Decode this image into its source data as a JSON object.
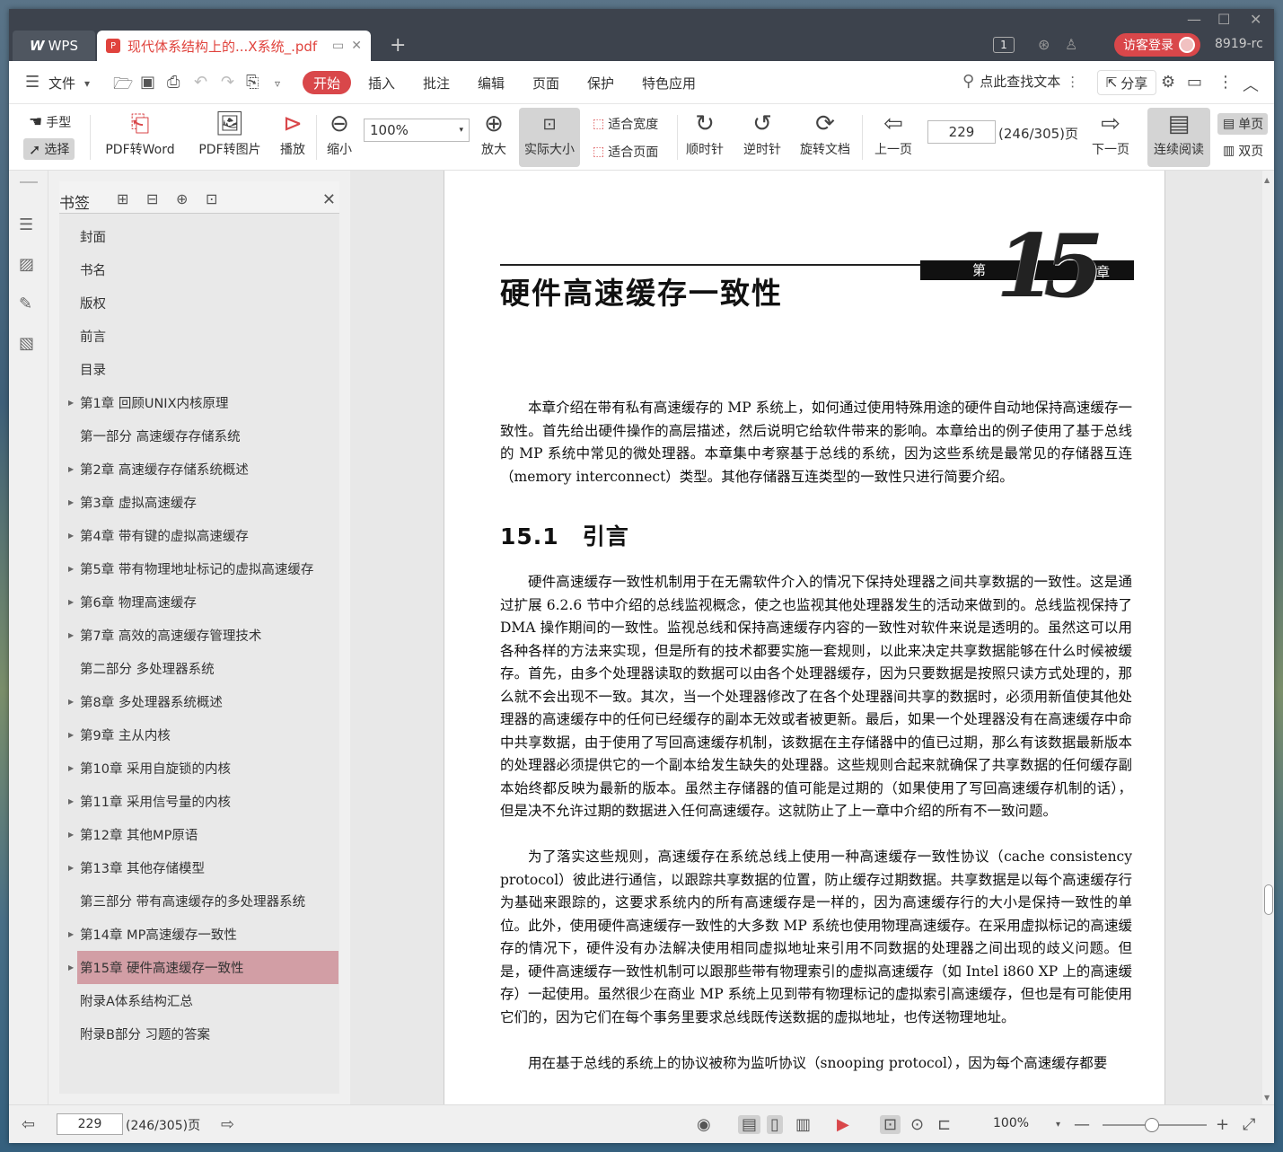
{
  "titlebar": {
    "app_tab": "WPS",
    "doc_tab_title": "现代体系结构上的...X系统_.pdf",
    "new_tab": "+",
    "badge": "1",
    "login": "访客登录",
    "user": "8919-rc",
    "min": "—",
    "max": "☐",
    "close": "✕"
  },
  "menu": {
    "file": "文件",
    "start": "开始",
    "insert": "插入",
    "annotate": "批注",
    "edit": "编辑",
    "page": "页面",
    "protect": "保护",
    "special": "特色应用",
    "search": "点此查找文本",
    "share": "分享"
  },
  "toolbar": {
    "hand": "手型",
    "select": "选择",
    "pdf_to_word": "PDF转Word",
    "pdf_to_image": "PDF转图片",
    "play": "播放",
    "zoom_out": "缩小",
    "zoom_value": "100%",
    "zoom_in": "放大",
    "actual_size": "实际大小",
    "fit_width": "适合宽度",
    "fit_page": "适合页面",
    "clockwise": "顺时针",
    "counterclockwise": "逆时针",
    "rotate_doc": "旋转文档",
    "prev_page": "上一页",
    "page_value": "229",
    "page_total": "(246/305)页",
    "next_page": "下一页",
    "continuous": "连续阅读",
    "single": "单页",
    "double": "双页"
  },
  "bookmark": {
    "title": "书签",
    "items": [
      {
        "label": "封面",
        "arrow": false,
        "active": false
      },
      {
        "label": "书名",
        "arrow": false,
        "active": false
      },
      {
        "label": "版权",
        "arrow": false,
        "active": false
      },
      {
        "label": "前言",
        "arrow": false,
        "active": false
      },
      {
        "label": "目录",
        "arrow": false,
        "active": false
      },
      {
        "label": "第1章 回顾UNIX内核原理",
        "arrow": true,
        "active": false
      },
      {
        "label": "第一部分 高速缓存存储系统",
        "arrow": false,
        "active": false
      },
      {
        "label": "第2章 高速缓存存储系统概述",
        "arrow": true,
        "active": false
      },
      {
        "label": "第3章 虚拟高速缓存",
        "arrow": true,
        "active": false
      },
      {
        "label": "第4章 带有键的虚拟高速缓存",
        "arrow": true,
        "active": false
      },
      {
        "label": "第5章 带有物理地址标记的虚拟高速缓存",
        "arrow": true,
        "active": false
      },
      {
        "label": "第6章 物理高速缓存",
        "arrow": true,
        "active": false
      },
      {
        "label": "第7章 高效的高速缓存管理技术",
        "arrow": true,
        "active": false
      },
      {
        "label": "第二部分 多处理器系统",
        "arrow": false,
        "active": false
      },
      {
        "label": "第8章 多处理器系统概述",
        "arrow": true,
        "active": false
      },
      {
        "label": "第9章 主从内核",
        "arrow": true,
        "active": false
      },
      {
        "label": "第10章 采用自旋锁的内核",
        "arrow": true,
        "active": false
      },
      {
        "label": "第11章 采用信号量的内核",
        "arrow": true,
        "active": false
      },
      {
        "label": "第12章 其他MP原语",
        "arrow": true,
        "active": false
      },
      {
        "label": "第13章 其他存储模型",
        "arrow": true,
        "active": false
      },
      {
        "label": "第三部分 带有高速缓存的多处理器系统",
        "arrow": false,
        "active": false
      },
      {
        "label": "第14章 MP高速缓存一致性",
        "arrow": true,
        "active": false
      },
      {
        "label": "第15章 硬件高速缓存一致性",
        "arrow": true,
        "active": true
      },
      {
        "label": "附录A体系结构汇总",
        "arrow": false,
        "active": false
      },
      {
        "label": "附录B部分 习题的答案",
        "arrow": false,
        "active": false
      }
    ]
  },
  "page": {
    "chapter_title": "硬件高速缓存一致性",
    "chapter_di": "第",
    "chapter_num": "15",
    "chapter_zhang": "章",
    "intro": "本章介绍在带有私有高速缓存的 MP 系统上，如何通过使用特殊用途的硬件自动地保持高速缓存一致性。首先给出硬件操作的高层描述，然后说明它给软件带来的影响。本章给出的例子使用了基于总线的 MP 系统中常见的微处理器。本章集中考察基于总线的系统，因为这些系统是最常见的存储器互连（memory interconnect）类型。其他存储器互连类型的一致性只进行简要介绍。",
    "section_num": "15.1",
    "section_title": "引言",
    "p1": "硬件高速缓存一致性机制用于在无需软件介入的情况下保持处理器之间共享数据的一致性。这是通过扩展 6.2.6 节中介绍的总线监视概念，使之也监视其他处理器发生的活动来做到的。总线监视保持了 DMA 操作期间的一致性。监视总线和保持高速缓存内容的一致性对软件来说是透明的。虽然这可以用各种各样的方法来实现，但是所有的技术都要实施一套规则，以此来决定共享数据能够在什么时候被缓存。首先，由多个处理器读取的数据可以由各个处理器缓存，因为只要数据是按照只读方式处理的，那么就不会出现不一致。其次，当一个处理器修改了在各个处理器间共享的数据时，必须用新值使其他处理器的高速缓存中的任何已经缓存的副本无效或者被更新。最后，如果一个处理器没有在高速缓存中命中共享数据，由于使用了写回高速缓存机制，该数据在主存储器中的值已过期，那么有该数据最新版本的处理器必须提供它的一个副本给发生缺失的处理器。这些规则合起来就确保了共享数据的任何缓存副本始终都反映为最新的版本。虽然主存储器的值可能是过期的（如果使用了写回高速缓存机制的话），但是决不允许过期的数据进入任何高速缓存。这就防止了上一章中介绍的所有不一致问题。",
    "p2": "为了落实这些规则，高速缓存在系统总线上使用一种高速缓存一致性协议（cache consistency protocol）彼此进行通信，以跟踪共享数据的位置，防止缓存过期数据。共享数据是以每个高速缓存行为基础来跟踪的，这要求系统内的所有高速缓存是一样的，因为高速缓存行的大小是保持一致性的单位。此外，使用硬件高速缓存一致性的大多数 MP 系统也使用物理高速缓存。在采用虚拟标记的高速缓存的情况下，硬件没有办法解决使用相同虚拟地址来引用不同数据的处理器之间出现的歧义问题。但是，硬件高速缓存一致性机制可以跟那些带有物理索引的虚拟高速缓存（如 Intel i860 XP 上的高速缓存）一起使用。虽然很少在商业 MP 系统上见到带有物理标记的虚拟索引高速缓存，但也是有可能使用它们的，因为它们在每个事务里要求总线既传送数据的虚拟地址，也传送物理地址。",
    "p3": "用在基于总线的系统上的协议被称为监听协议（snooping protocol），因为每个高速缓存都要"
  },
  "status": {
    "page_value": "229",
    "page_total": "(246/305)页",
    "zoom": "100%"
  }
}
